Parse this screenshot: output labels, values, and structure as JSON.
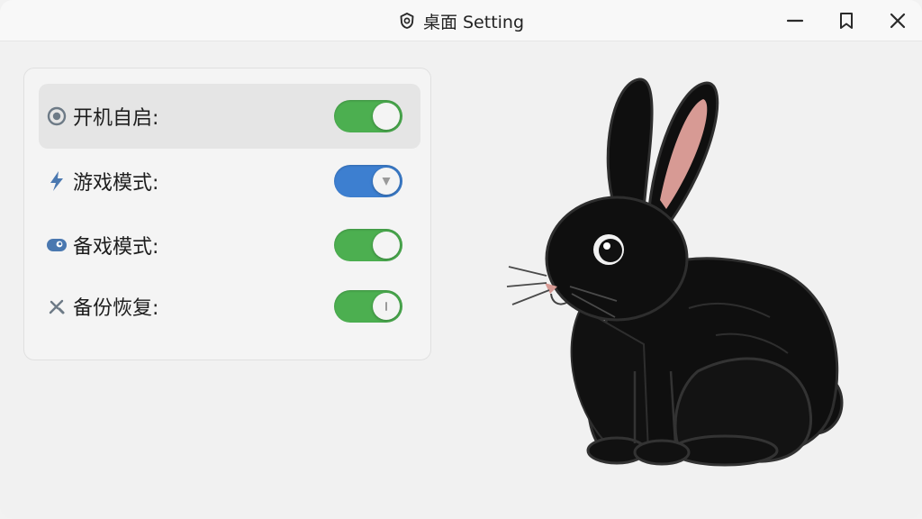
{
  "window": {
    "title": "桌面 Setting",
    "app_icon": "shield-outline-icon",
    "controls": [
      "minimize-icon",
      "bookmark-icon",
      "close-icon"
    ]
  },
  "settings": {
    "items": [
      {
        "label": "开机自启:",
        "icon": "radio-target-icon",
        "toggle_on": true,
        "toggle_color": "#4caf50",
        "highlighted": true
      },
      {
        "label": "游戏模式:",
        "icon": "lightning-icon",
        "toggle_on": true,
        "toggle_color": "#3d7fd0",
        "highlighted": false
      },
      {
        "label": "备戏模式:",
        "icon": "eye-capsule-icon",
        "toggle_on": true,
        "toggle_color": "#4caf50",
        "highlighted": false
      },
      {
        "label": "备份恢复:",
        "icon": "tools-icon",
        "toggle_on": true,
        "toggle_color": "#4caf50",
        "highlighted": false
      }
    ]
  },
  "illustration": {
    "subject": "black-rabbit-illustration"
  },
  "colors": {
    "toggle_green": "#4caf50",
    "toggle_blue": "#3d7fd0",
    "icon_gray": "#6d7a86",
    "icon_blue": "#4a78b0"
  }
}
